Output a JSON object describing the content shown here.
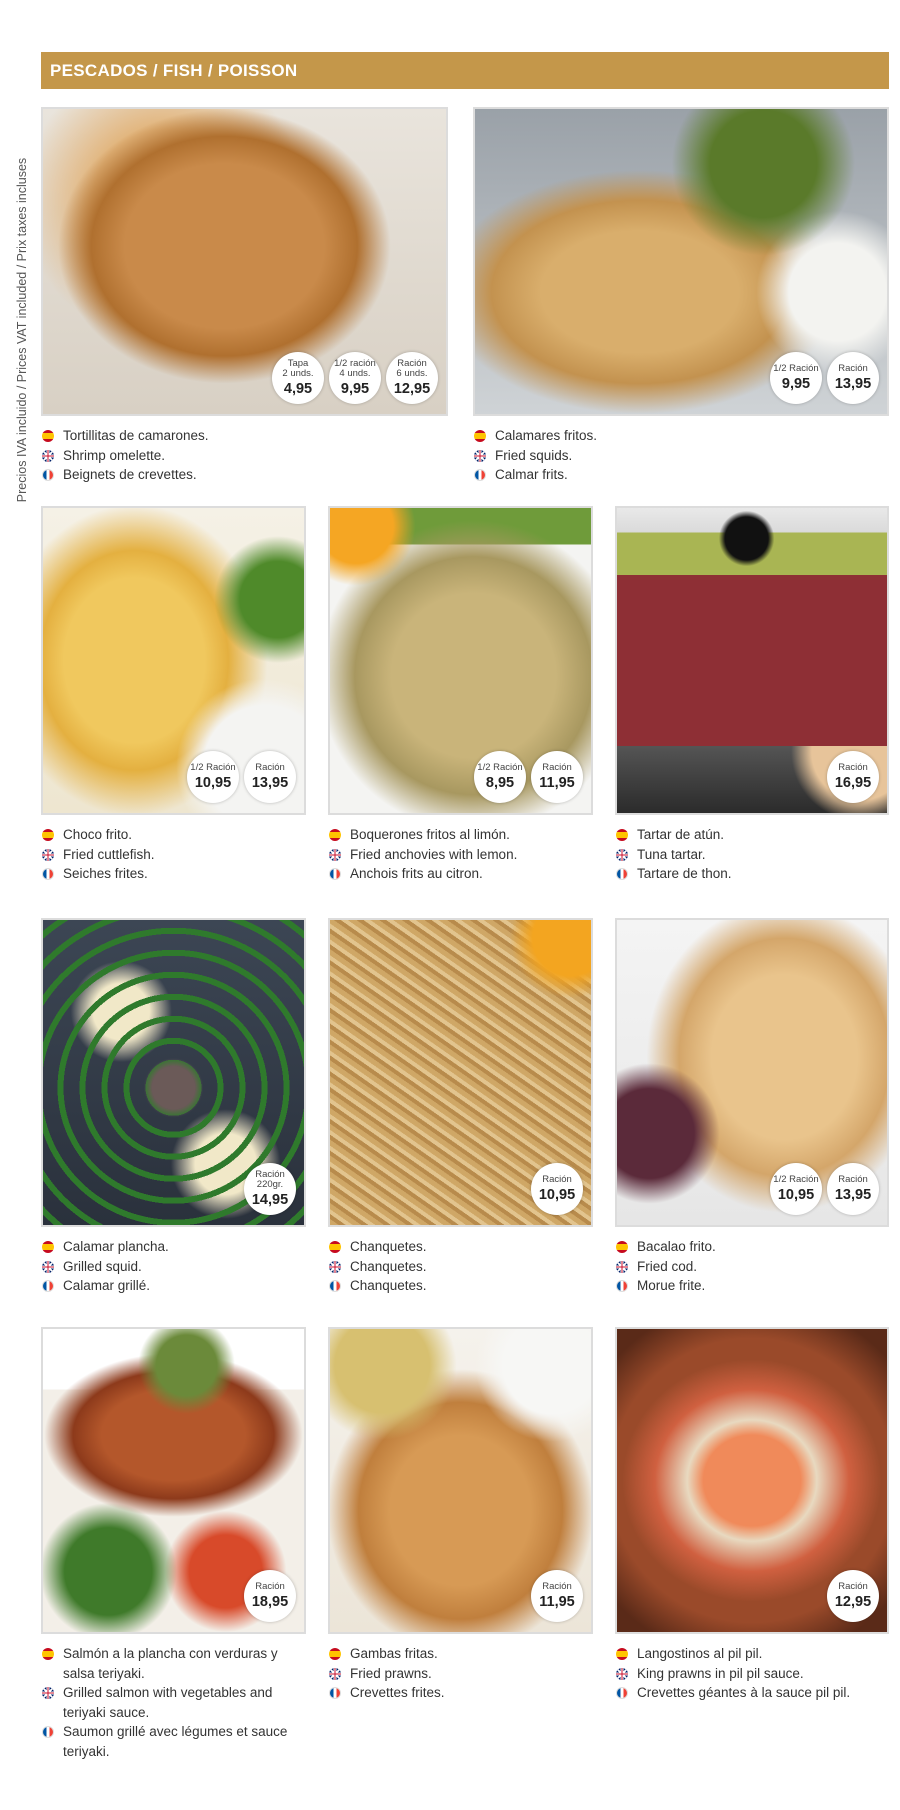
{
  "side_note": "Precios IVA incluido / Prices VAT included / Prix taxes incluses",
  "section_title": "PESCADOS / FISH / POISSON",
  "items": [
    {
      "name": "tortillitas",
      "prices": [
        {
          "label": "Tapa\n2 unds.",
          "value": "4,95"
        },
        {
          "label": "1/2 ración\n4 unds.",
          "value": "9,95"
        },
        {
          "label": "Ración\n6 unds.",
          "value": "12,95"
        }
      ],
      "es": "Tortillitas de camarones.",
      "en": "Shrimp omelette.",
      "fr": "Beignets de crevettes."
    },
    {
      "name": "calamares",
      "prices": [
        {
          "label": "1/2 Ración",
          "value": "9,95"
        },
        {
          "label": "Ración",
          "value": "13,95"
        }
      ],
      "es": "Calamares fritos.",
      "en": "Fried squids.",
      "fr": "Calmar frits."
    },
    {
      "name": "choco",
      "prices": [
        {
          "label": "1/2 Ración",
          "value": "10,95"
        },
        {
          "label": "Ración",
          "value": "13,95"
        }
      ],
      "es": "Choco frito.",
      "en": "Fried cuttlefish.",
      "fr": "Seiches frites."
    },
    {
      "name": "boquerones",
      "prices": [
        {
          "label": "1/2 Ración",
          "value": "8,95"
        },
        {
          "label": "Ración",
          "value": "11,95"
        }
      ],
      "es": "Boquerones fritos al limón.",
      "en": "Fried anchovies with lemon.",
      "fr": "Anchois frits au citron."
    },
    {
      "name": "tartar",
      "prices": [
        {
          "label": "Ración",
          "value": "16,95"
        }
      ],
      "es": "Tartar de atún.",
      "en": "Tuna tartar.",
      "fr": "Tartare de thon."
    },
    {
      "name": "calamar-plancha",
      "prices": [
        {
          "label": "Ración\n220gr.",
          "value": "14,95"
        }
      ],
      "es": "Calamar plancha.",
      "en": "Grilled squid.",
      "fr": "Calamar grillé."
    },
    {
      "name": "chanquetes",
      "prices": [
        {
          "label": "Ración",
          "value": "10,95"
        }
      ],
      "es": "Chanquetes.",
      "en": "Chanquetes.",
      "fr": "Chanquetes."
    },
    {
      "name": "bacalao",
      "prices": [
        {
          "label": "1/2 Ración",
          "value": "10,95"
        },
        {
          "label": "Ración",
          "value": "13,95"
        }
      ],
      "es": "Bacalao frito.",
      "en": "Fried cod.",
      "fr": "Morue frite."
    },
    {
      "name": "salmon",
      "prices": [
        {
          "label": "Ración",
          "value": "18,95"
        }
      ],
      "es": "Salmón a la plancha con verduras y salsa teriyaki.",
      "en": "Grilled salmon with vegetables and teriyaki sauce.",
      "fr": "Saumon grillé avec légumes et sauce teriyaki."
    },
    {
      "name": "gambas",
      "prices": [
        {
          "label": "Ración",
          "value": "11,95"
        }
      ],
      "es": "Gambas fritas.",
      "en": "Fried prawns.",
      "fr": "Crevettes frites."
    },
    {
      "name": "langostinos",
      "prices": [
        {
          "label": "Ración",
          "value": "12,95"
        }
      ],
      "es": "Langostinos al pil pil.",
      "en": "King prawns in pil pil sauce.",
      "fr": "Crevettes géantes à la sauce pil pil."
    }
  ]
}
